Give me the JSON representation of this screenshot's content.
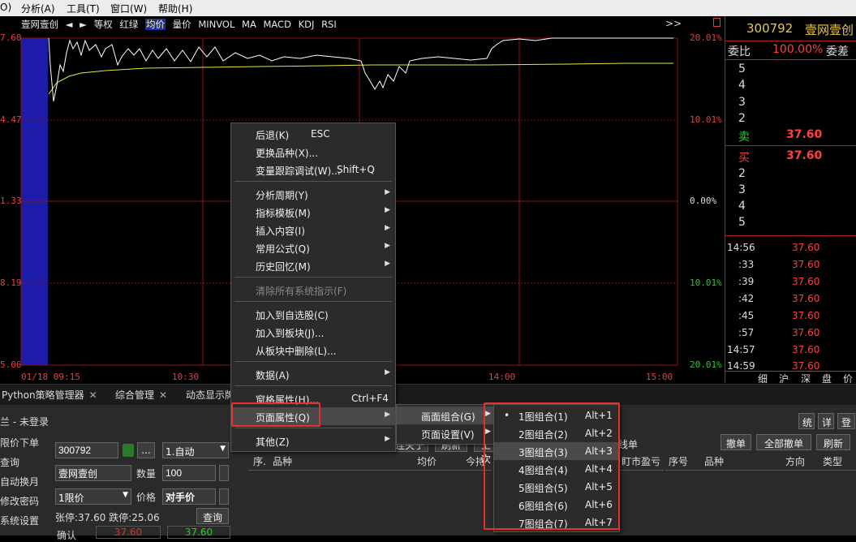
{
  "menubar": {
    "items": [
      "O)",
      "分析(A)",
      "工具(T)",
      "窗口(W)",
      "帮助(H)"
    ]
  },
  "chart": {
    "toolbar": {
      "stock_name": "壹网壹创",
      "prev": "◄",
      "next": "►",
      "items": [
        "等权",
        "红绿",
        "均价",
        "量价",
        "MINVOL",
        "MA",
        "MACD",
        "KDJ",
        "RSI"
      ],
      "selected": "均价",
      "more": ">>"
    },
    "left_axis": [
      "7.60",
      "4.47",
      "1.33",
      "8.19",
      "5.06"
    ],
    "right_axis": [
      "20.01%",
      "10.01%",
      "0.00%",
      "10.01%",
      "20.01%"
    ],
    "x_axis": [
      "01/18 09:15",
      "10:30",
      "14:00",
      "15:00"
    ],
    "colors": {
      "price": "#ffffff",
      "avg": "#e8e83a",
      "grid": "#8b1515",
      "volume": "#1c1ca8"
    }
  },
  "quote": {
    "code": "300792",
    "name": "壹网壹创",
    "weibi_label": "委比",
    "weibi_value": "100.00%",
    "weicha_label": "委差",
    "sell_levels": [
      "5",
      "4",
      "3",
      "2"
    ],
    "sell_label": "卖",
    "sell_price": "37.60",
    "buy_label": "买",
    "buy_price": "37.60",
    "buy_levels": [
      "2",
      "3",
      "4",
      "5"
    ],
    "ticks": [
      {
        "t": "14:56",
        "p": "37.60"
      },
      {
        "t": ":33",
        "p": "37.60"
      },
      {
        "t": ":39",
        "p": "37.60"
      },
      {
        "t": ":42",
        "p": "37.60"
      },
      {
        "t": ":45",
        "p": "37.60"
      },
      {
        "t": ":57",
        "p": "37.60"
      },
      {
        "t": "14:57",
        "p": "37.60"
      },
      {
        "t": "14:59",
        "p": "37.60"
      }
    ],
    "bottom_tabs": [
      "细",
      "沪",
      "深",
      "盘",
      "价"
    ]
  },
  "tabs": [
    {
      "label": "Python策略管理器",
      "close": "✕"
    },
    {
      "label": "综合管理",
      "close": "✕"
    },
    {
      "label": "动态显示牌",
      "close": ""
    }
  ],
  "trade": {
    "title": "兰 - 未登录",
    "left_menu": [
      "限价下单",
      "查询",
      "自动换月",
      "修改密码",
      "系统设置"
    ],
    "code_value": "300792",
    "auto_label": "1.自动",
    "name_value": "壹网壹创",
    "qty_label": "数量",
    "qty_value": "100",
    "type_value": "1限价",
    "price_label": "价格",
    "price_value": "对手价",
    "limits": "张停:37.60 跌停:25.06",
    "query_btn": "查询",
    "bottom_left_label": "确认",
    "price_red": "37.60",
    "price_green": "37.60",
    "grid_headers": [
      "序.",
      "品种",
      "均价",
      "今持"
    ],
    "right_buttons_top": [
      "统",
      "详",
      "登"
    ],
    "right_buttons": [
      "撤单",
      "全部撤单",
      "刷新"
    ],
    "right_headers": [
      "序号",
      "品种",
      "方向",
      "类型"
    ],
    "mid_header": "盯市盈亏",
    "mid_btn": "线单",
    "partial_btns": [
      "连关于",
      "刷新",
      "上次"
    ]
  },
  "context_menu": {
    "items": [
      {
        "label": "后退(K)",
        "accel": "ESC"
      },
      {
        "label": "更换品种(X)...",
        "accel": ""
      },
      {
        "label": "变量跟踪调试(W)...",
        "accel": "Shift+Q"
      },
      {
        "label": "分析周期(Y)",
        "submenu": true
      },
      {
        "label": "指标模板(M)",
        "submenu": true
      },
      {
        "label": "插入内容(I)",
        "submenu": true
      },
      {
        "label": "常用公式(Q)",
        "submenu": true
      },
      {
        "label": "历史回忆(M)",
        "submenu": true
      },
      {
        "label": "清除所有系统指示(F)",
        "disabled": true
      },
      {
        "label": "加入到自选股(C)",
        "accel": ""
      },
      {
        "label": "加入到板块(J)...",
        "accel": ""
      },
      {
        "label": "从板块中删除(L)...",
        "accel": ""
      },
      {
        "label": "数据(A)",
        "submenu": true
      },
      {
        "label": "窗格属性(H)...",
        "accel": "Ctrl+F4"
      },
      {
        "label": "页面属性(Q)",
        "submenu": true
      },
      {
        "label": "其他(Z)",
        "submenu": true
      }
    ]
  },
  "submenu1": {
    "items": [
      {
        "label": "画面组合(G)"
      },
      {
        "label": "页面设置(V)"
      }
    ]
  },
  "submenu2": {
    "items": [
      {
        "label": "1图组合(1)",
        "accel": "Alt+1",
        "checked": true
      },
      {
        "label": "2图组合(2)",
        "accel": "Alt+2"
      },
      {
        "label": "3图组合(3)",
        "accel": "Alt+3"
      },
      {
        "label": "4图组合(4)",
        "accel": "Alt+4"
      },
      {
        "label": "5图组合(5)",
        "accel": "Alt+5"
      },
      {
        "label": "6图组合(6)",
        "accel": "Alt+6"
      },
      {
        "label": "7图组合(7)",
        "accel": "Alt+7"
      }
    ],
    "bullet": "•"
  }
}
